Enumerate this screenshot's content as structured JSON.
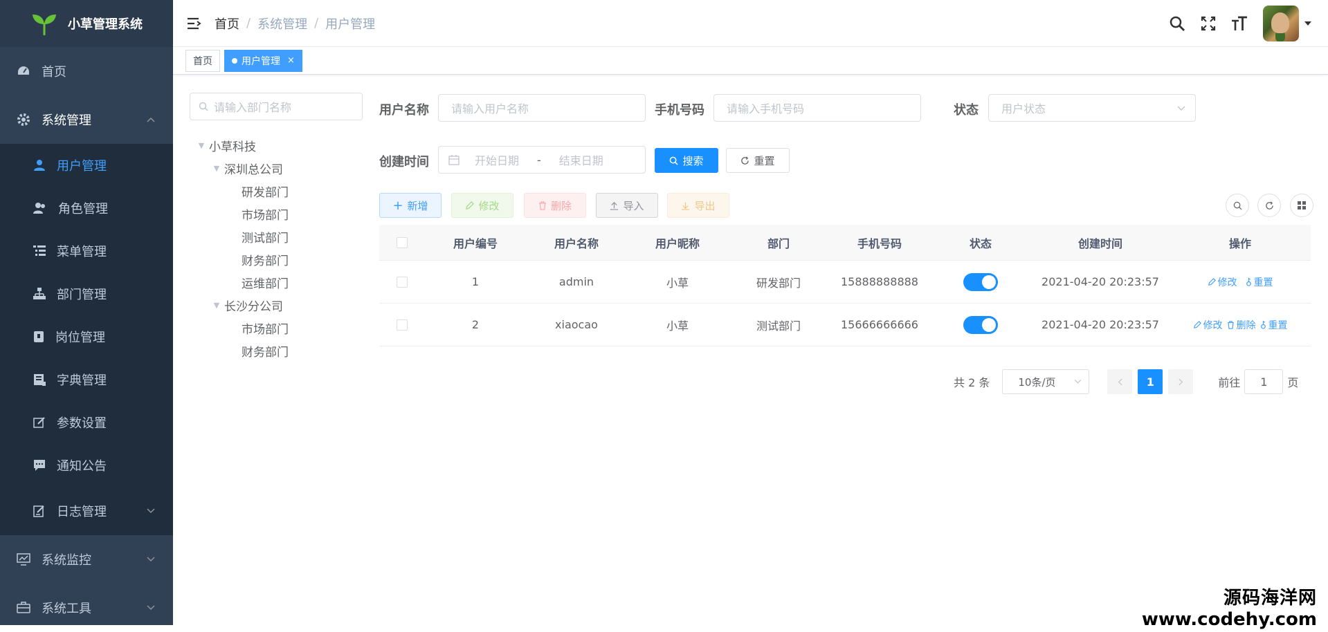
{
  "app": {
    "title": "小草管理系统"
  },
  "sidebar": {
    "items": [
      {
        "label": "首页"
      },
      {
        "label": "系统管理"
      },
      {
        "label": "系统监控"
      },
      {
        "label": "系统工具"
      }
    ],
    "sub_items": [
      {
        "label": "用户管理"
      },
      {
        "label": "角色管理"
      },
      {
        "label": "菜单管理"
      },
      {
        "label": "部门管理"
      },
      {
        "label": "岗位管理"
      },
      {
        "label": "字典管理"
      },
      {
        "label": "参数设置"
      },
      {
        "label": "通知公告"
      },
      {
        "label": "日志管理"
      }
    ]
  },
  "header": {
    "breadcrumb": [
      "首页",
      "系统管理",
      "用户管理"
    ]
  },
  "tags": {
    "home": "首页",
    "active": "用户管理",
    "close": "×"
  },
  "tree": {
    "placeholder": "请输入部门名称",
    "root": "小草科技",
    "branch1": "深圳总公司",
    "branch1_children": [
      "研发部门",
      "市场部门",
      "测试部门",
      "财务部门",
      "运维部门"
    ],
    "branch2": "长沙分公司",
    "branch2_children": [
      "市场部门",
      "财务部门"
    ]
  },
  "form": {
    "username_label": "用户名称",
    "username_placeholder": "请输入用户名称",
    "phone_label": "手机号码",
    "phone_placeholder": "请输入手机号码",
    "status_label": "状态",
    "status_placeholder": "用户状态",
    "created_label": "创建时间",
    "start_placeholder": "开始日期",
    "range_sep": "-",
    "end_placeholder": "结束日期",
    "search": "搜索",
    "reset": "重置"
  },
  "toolbar": {
    "add": "新增",
    "edit": "修改",
    "delete": "删除",
    "import": "导入",
    "export": "导出"
  },
  "table": {
    "headers": [
      "用户编号",
      "用户名称",
      "用户昵称",
      "部门",
      "手机号码",
      "状态",
      "创建时间",
      "操作"
    ],
    "rows": [
      {
        "id": "1",
        "username": "admin",
        "nickname": "小草",
        "dept": "研发部门",
        "phone": "15888888888",
        "created": "2021-04-20 20:23:57",
        "ops": [
          "修改",
          "重置"
        ]
      },
      {
        "id": "2",
        "username": "xiaocao",
        "nickname": "小草",
        "dept": "测试部门",
        "phone": "15666666666",
        "created": "2021-04-20 20:23:57",
        "ops": [
          "修改",
          "删除",
          "重置"
        ]
      }
    ]
  },
  "pager": {
    "total": "共 2 条",
    "size": "10条/页",
    "current": "1",
    "goto": "前往",
    "goto_value": "1",
    "page_unit": "页"
  },
  "watermark": {
    "line1": "源码海洋网",
    "line2": "www.codehy.com"
  },
  "colors": {
    "sidebar": "#304156",
    "primary": "#1890ff",
    "active_menu": "#409eff"
  }
}
